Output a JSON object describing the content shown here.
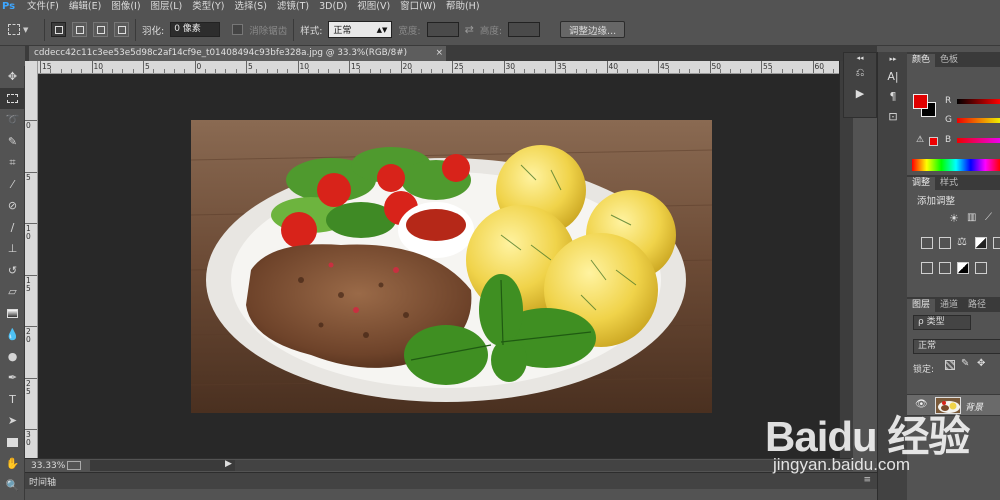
{
  "app": {
    "logo": "Ps"
  },
  "menu": [
    "文件(F)",
    "编辑(E)",
    "图像(I)",
    "图层(L)",
    "类型(Y)",
    "选择(S)",
    "滤镜(T)",
    "3D(D)",
    "视图(V)",
    "窗口(W)",
    "帮助(H)"
  ],
  "options": {
    "feather_label": "羽化:",
    "feather_value": "0 像素",
    "antialias_label": "消除锯齿",
    "style_label": "样式:",
    "style_value": "正常",
    "width_label": "宽度:",
    "height_label": "高度:",
    "refine_button": "调整边缘..."
  },
  "document": {
    "tab_title": "cddecc42c11c3ee53e5d98c2af14cf9e_t01408494c93bfe328a.jpg @ 33.3%(RGB/8#)",
    "close": "×"
  },
  "ruler": {
    "h_labels": [
      "15",
      "10",
      "5",
      "0",
      "5",
      "10",
      "15",
      "20",
      "25",
      "30",
      "35",
      "40",
      "45",
      "50",
      "55",
      "60"
    ],
    "v_labels": [
      "0",
      "5",
      "1 0",
      "1 5",
      "2 0",
      "2 5",
      "3 0"
    ]
  },
  "status": {
    "zoom": "33.33%",
    "play": "▶"
  },
  "timeline": {
    "tab": "时间轴",
    "menu": "≡"
  },
  "panels": {
    "color_tabs": [
      "颜色",
      "色板"
    ],
    "color_channels": [
      "R",
      "G",
      "B"
    ],
    "foreground_color": "#e00000",
    "background_color": "#000000",
    "adjust_tabs": [
      "调整",
      "样式"
    ],
    "adjust_title": "添加调整",
    "layers_tabs": [
      "图层",
      "通道",
      "路径"
    ],
    "layers_filter": "ρ 类型",
    "blend_mode": "正常",
    "lock_label": "锁定:",
    "layer_name": "背景"
  },
  "watermark": {
    "word": "Baidu 经验",
    "url": "jingyan.baidu.com"
  }
}
